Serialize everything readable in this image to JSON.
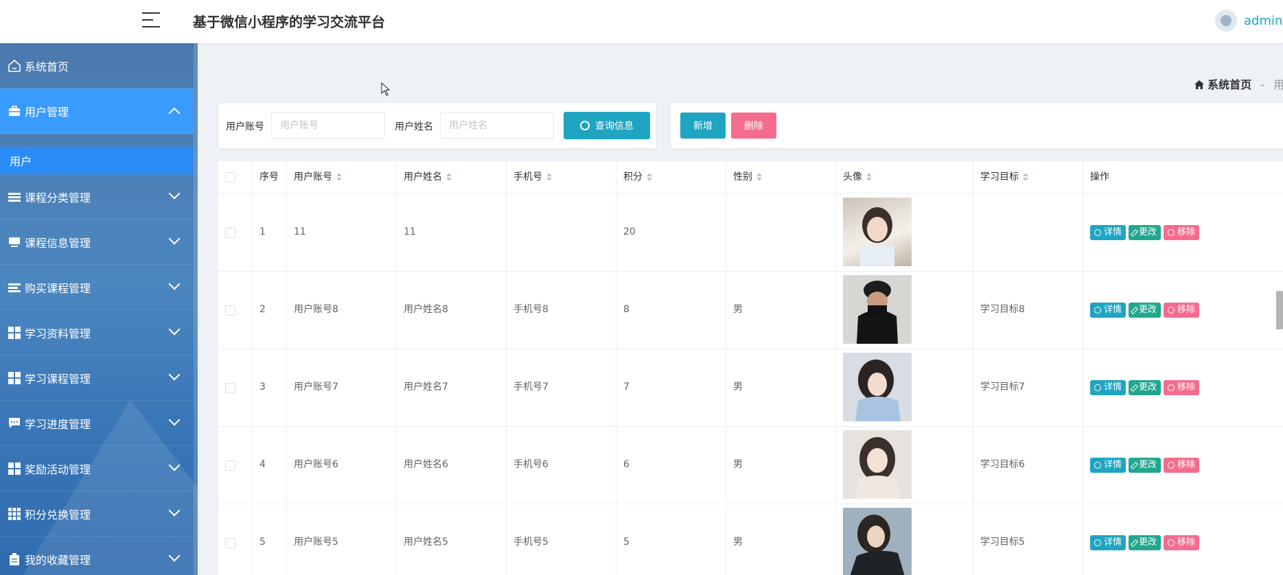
{
  "header": {
    "title": "基于微信小程序的学习交流平台",
    "user_name": "admin"
  },
  "sidebar": {
    "home": "系统首页",
    "items": [
      {
        "label": "用户管理",
        "icon": "briefcase-icon",
        "expanded": true
      },
      {
        "label": "课程分类管理",
        "icon": "list-icon"
      },
      {
        "label": "课程信息管理",
        "icon": "monitor-icon"
      },
      {
        "label": "购买课程管理",
        "icon": "list-icon"
      },
      {
        "label": "学习资料管理",
        "icon": "grid-icon"
      },
      {
        "label": "学习课程管理",
        "icon": "grid-icon"
      },
      {
        "label": "学习进度管理",
        "icon": "chat-icon"
      },
      {
        "label": "奖励活动管理",
        "icon": "grid-icon"
      },
      {
        "label": "积分兑换管理",
        "icon": "apps-icon"
      },
      {
        "label": "我的收藏管理",
        "icon": "clipboard-icon"
      }
    ],
    "sub_item": "用户"
  },
  "breadcrumb": {
    "home": "系统首页",
    "separator": "-",
    "current": "用户"
  },
  "search": {
    "account_label": "用户账号",
    "account_placeholder": "用户账号",
    "name_label": "用户姓名",
    "name_placeholder": "用户姓名",
    "query_button": "查询信息"
  },
  "actions": {
    "add": "新增",
    "delete": "删除"
  },
  "table": {
    "headers": [
      "序号",
      "用户账号",
      "用户姓名",
      "手机号",
      "积分",
      "性别",
      "头像",
      "学习目标",
      "操作"
    ],
    "ops": {
      "detail": "详情",
      "edit": "更改",
      "remove": "移除"
    },
    "rows": [
      {
        "no": "1",
        "account": "11",
        "name": "11",
        "phone": "",
        "points": "20",
        "gender": "",
        "goal": ""
      },
      {
        "no": "2",
        "account": "用户账号8",
        "name": "用户姓名8",
        "phone": "手机号8",
        "points": "8",
        "gender": "男",
        "goal": "学习目标8"
      },
      {
        "no": "3",
        "account": "用户账号7",
        "name": "用户姓名7",
        "phone": "手机号7",
        "points": "7",
        "gender": "男",
        "goal": "学习目标7"
      },
      {
        "no": "4",
        "account": "用户账号6",
        "name": "用户姓名6",
        "phone": "手机号6",
        "points": "6",
        "gender": "男",
        "goal": "学习目标6"
      },
      {
        "no": "5",
        "account": "用户账号5",
        "name": "用户姓名5",
        "phone": "手机号5",
        "points": "5",
        "gender": "男",
        "goal": "学习目标5"
      }
    ]
  },
  "colors": {
    "primary": "#1fa4c1",
    "danger": "#f46d8f",
    "edit": "#22a78f",
    "sidebar_active": "#3a9bff"
  }
}
